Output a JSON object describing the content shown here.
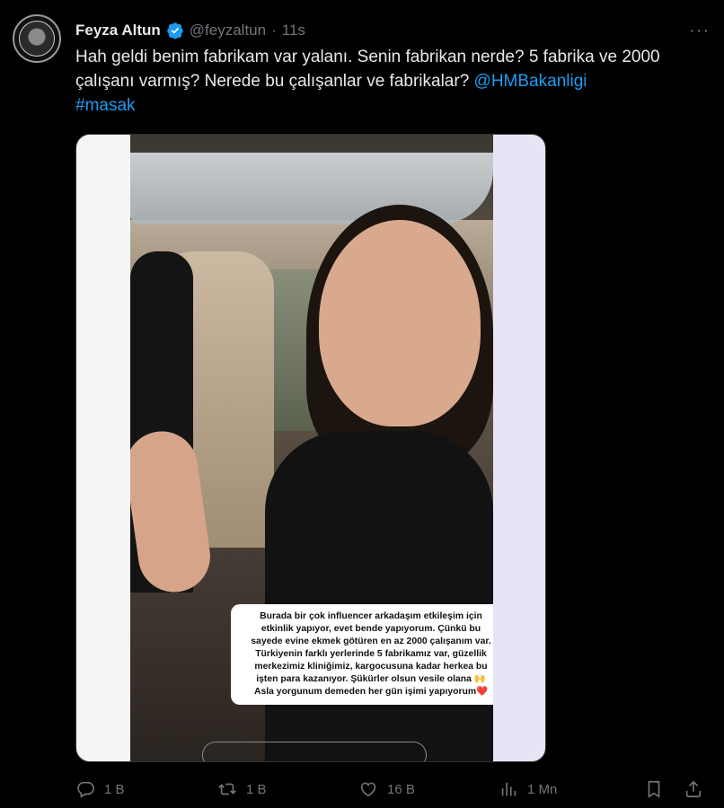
{
  "tweet": {
    "author_name": "Feyza Altun",
    "handle": "@feyzaltun",
    "separator": "·",
    "time": "11s",
    "more": "···",
    "text_main": "Hah geldi benim fabrikam var yalanı. Senin fabrikan nerde? 5 fabrika ve 2000 çalışanı varmış? Nerede bu çalışanlar ve fabrikalar? ",
    "mention": "@HMBakanligi",
    "hashtag": "#masak"
  },
  "media": {
    "caption_lines": [
      "Burada bir çok influencer arkadaşım etkileşim için",
      "etkinlik yapıyor, evet bende yapıyorum. Çünkü bu",
      "sayede evine ekmek götüren en az 2000 çalışanım var.",
      "Türkiyenin farklı yerlerinde 5 fabrikamız var, güzellik",
      "merkezimiz kliniğimiz, kargocusuna kadar herkea bu",
      "işten para kazanıyor. Şükürler olsun vesile olana 🙌",
      "Asla yorgunum demeden her gün işimi yapıyorum❤️"
    ]
  },
  "actions": {
    "replies": "1 B",
    "retweets": "1 B",
    "likes": "16 B",
    "views": "1 Mn"
  },
  "colors": {
    "accent": "#1d9bf0",
    "muted": "#71767b",
    "text": "#e7e9ea",
    "background": "#000000"
  }
}
